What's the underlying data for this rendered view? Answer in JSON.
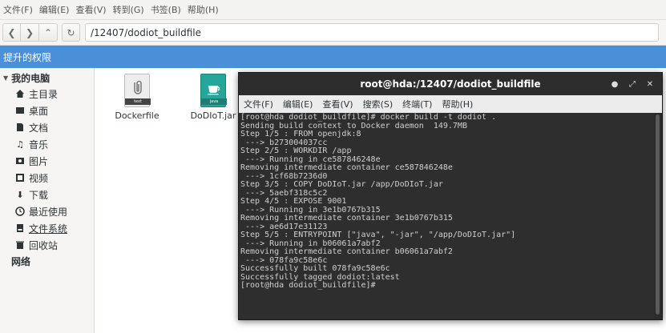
{
  "menubar": [
    "文件(F)",
    "编辑(E)",
    "查看(V)",
    "转到(G)",
    "书签(B)",
    "帮助(H)"
  ],
  "location": "/12407/dodiot_buildfile",
  "infobar": "提升的权限",
  "sidebar": {
    "my_computer": "我的电脑",
    "items": [
      {
        "label": "主目录",
        "icon": "home-icon"
      },
      {
        "label": "桌面",
        "icon": "desktop-icon"
      },
      {
        "label": "文档",
        "icon": "documents-icon"
      },
      {
        "label": "音乐",
        "icon": "music-icon"
      },
      {
        "label": "图片",
        "icon": "pictures-icon"
      },
      {
        "label": "视频",
        "icon": "videos-icon"
      },
      {
        "label": "下载",
        "icon": "download-icon"
      },
      {
        "label": "最近使用",
        "icon": "recent-icon"
      },
      {
        "label": "文件系统",
        "icon": "filesystem-icon"
      },
      {
        "label": "回收站",
        "icon": "trash-icon"
      }
    ],
    "network": "网络"
  },
  "files": [
    {
      "name": "Dockerfile",
      "tag": "text",
      "icon": "text-file-icon"
    },
    {
      "name": "DoDIoT.jar",
      "tag": "java",
      "icon": "java-file-icon"
    }
  ],
  "terminal": {
    "title": "root@hda:/12407/dodiot_buildfile",
    "menu": [
      "文件(F)",
      "编辑(E)",
      "查看(V)",
      "搜索(S)",
      "终端(T)",
      "帮助(H)"
    ],
    "lines": [
      "[root@hda dodiot_buildfile]# docker build -t dodiot .",
      "Sending build context to Docker daemon  149.7MB",
      "Step 1/5 : FROM openjdk:8",
      " ---> b273004037cc",
      "Step 2/5 : WORKDIR /app",
      " ---> Running in ce587846248e",
      "Removing intermediate container ce587846248e",
      " ---> 1cf68b7236d0",
      "Step 3/5 : COPY DoDIoT.jar /app/DoDIoT.jar",
      " ---> 5aebf318c5c2",
      "Step 4/5 : EXPOSE 9001",
      " ---> Running in 3e1b0767b315",
      "Removing intermediate container 3e1b0767b315",
      " ---> ae6d17e31123",
      "Step 5/5 : ENTRYPOINT [\"java\", \"-jar\", \"/app/DoDIoT.jar\"]",
      " ---> Running in b06061a7abf2",
      "Removing intermediate container b06061a7abf2",
      " ---> 078fa9c58e6c",
      "Successfully built 078fa9c58e6c",
      "Successfully tagged dodiot:latest",
      "[root@hda dodiot_buildfile]#"
    ]
  },
  "colors": {
    "infobar": "#4a90d9",
    "terminal_bg": "#2e2e2e"
  }
}
